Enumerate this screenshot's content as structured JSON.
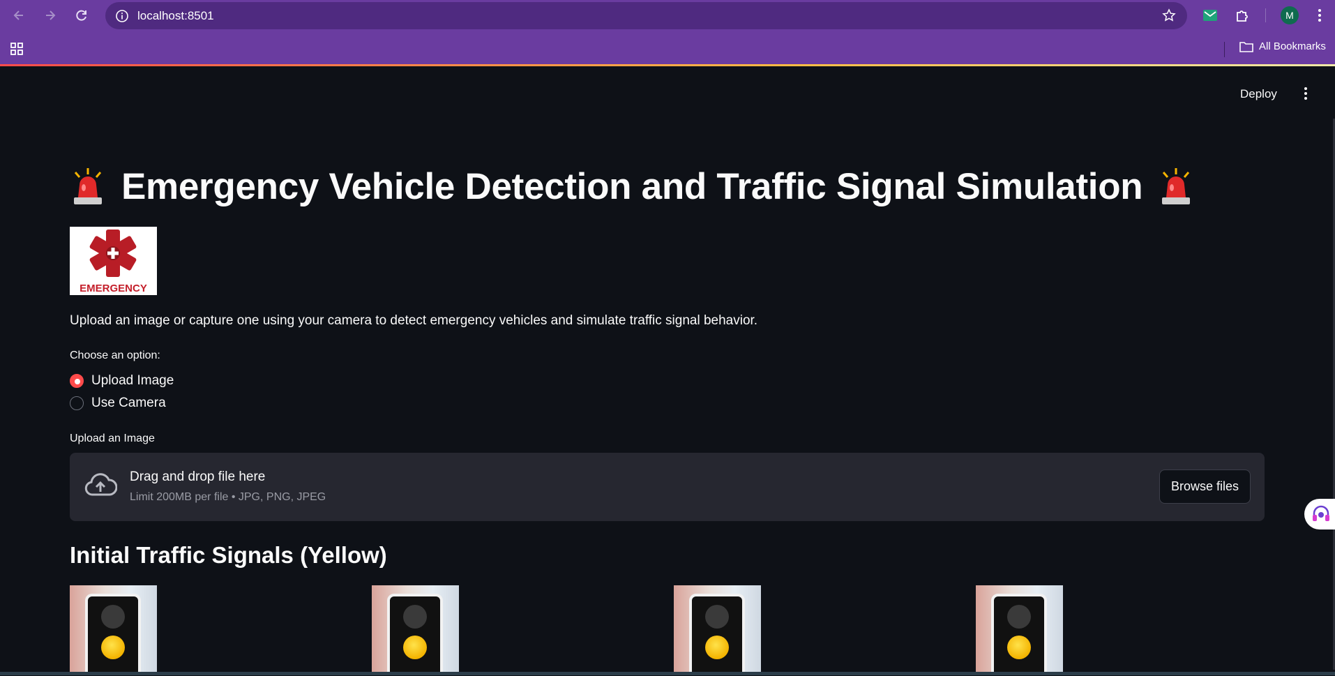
{
  "browser": {
    "url": "localhost:8501",
    "bookmarks_label": "All Bookmarks",
    "profile_initial": "M"
  },
  "app": {
    "deploy_label": "Deploy",
    "title": "Emergency Vehicle Detection and Traffic Signal Simulation",
    "logo_text": "EMERGENCY",
    "description": "Upload an image or capture one using your camera to detect emergency vehicles and simulate traffic signal behavior.",
    "choose_label": "Choose an option:",
    "options": [
      {
        "label": "Upload Image",
        "selected": true
      },
      {
        "label": "Use Camera",
        "selected": false
      }
    ],
    "upload_label": "Upload an Image",
    "dropzone": {
      "title": "Drag and drop file here",
      "subtitle": "Limit 200MB per file • JPG, PNG, JPEG",
      "button": "Browse files"
    },
    "signals_heading": "Initial Traffic Signals (Yellow)",
    "signals": [
      {
        "state": "yellow"
      },
      {
        "state": "yellow"
      },
      {
        "state": "yellow"
      },
      {
        "state": "yellow"
      }
    ]
  },
  "colors": {
    "chrome": "#6a3ca0",
    "app_bg": "#0e1117",
    "accent": "#ff4b4b",
    "dropzone_bg": "#262730"
  }
}
